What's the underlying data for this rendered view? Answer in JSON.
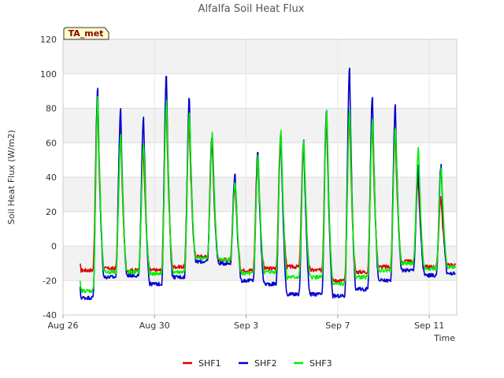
{
  "chart_data": {
    "type": "line",
    "title": "Alfalfa Soil Heat Flux",
    "xlabel": "Time",
    "ylabel": "Soil Heat Flux (W/m2)",
    "badge": "TA_met",
    "ylim": [
      -40,
      120
    ],
    "xlim": [
      0,
      17.2
    ],
    "yticks": [
      -40,
      -20,
      0,
      20,
      40,
      60,
      80,
      100,
      120
    ],
    "xticks": [
      {
        "value": 0,
        "label": "Aug 26"
      },
      {
        "value": 4,
        "label": "Aug 30"
      },
      {
        "value": 8,
        "label": "Sep 3"
      },
      {
        "value": 12,
        "label": "Sep 7"
      },
      {
        "value": 16,
        "label": "Sep 11"
      }
    ],
    "grid": true,
    "legend": "bottom-center",
    "x_unit": "days since Aug 26",
    "series": [
      {
        "name": "SHF1",
        "color": "#dd0000",
        "peaks": [
          50,
          85,
          70,
          58,
          85,
          75,
          63,
          38,
          55,
          65,
          60,
          77,
          80,
          75,
          68,
          40,
          29
        ],
        "mins": [
          -15,
          -14,
          -13,
          -14,
          -14,
          -12,
          -6,
          -8,
          -14,
          -13,
          -12,
          -14,
          -20,
          -15,
          -12,
          -9,
          -12,
          -11
        ]
      },
      {
        "name": "SHF2",
        "color": "#0000cc",
        "peaks": [
          85,
          92,
          80,
          74,
          100,
          87,
          65,
          42,
          55,
          65,
          62,
          80,
          105,
          88,
          82,
          47,
          48
        ],
        "mins": [
          -20,
          -30,
          -18,
          -17,
          -22,
          -18,
          -9,
          -10,
          -20,
          -22,
          -28,
          -28,
          -29,
          -25,
          -20,
          -14,
          -17,
          -16
        ]
      },
      {
        "name": "SHF3",
        "color": "#00ee00",
        "peaks": [
          68,
          87,
          65,
          60,
          85,
          77,
          66,
          38,
          53,
          67,
          62,
          78,
          80,
          75,
          70,
          57,
          45
        ],
        "mins": [
          -18,
          -26,
          -15,
          -15,
          -16,
          -15,
          -7,
          -8,
          -16,
          -15,
          -18,
          -18,
          -22,
          -18,
          -14,
          -10,
          -13,
          -12
        ]
      }
    ]
  }
}
